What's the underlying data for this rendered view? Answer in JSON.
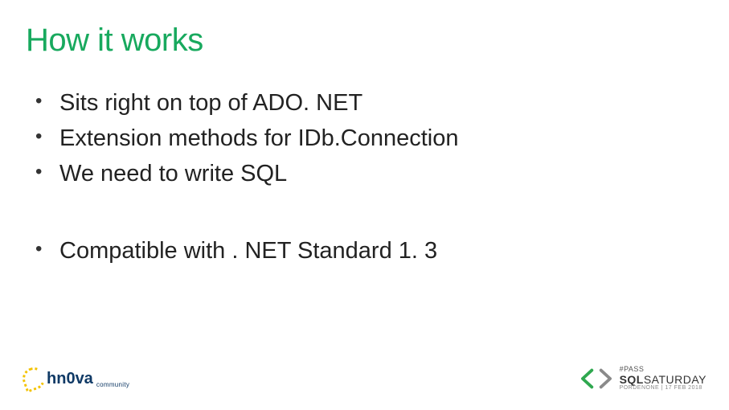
{
  "title": "How it works",
  "bullets_group1": [
    "Sits right on top of ADO. NET",
    "Extension methods for IDb.Connection",
    "We need to write SQL"
  ],
  "bullets_group2": [
    "Compatible with . NET Standard 1. 3"
  ],
  "footer": {
    "left": {
      "brand_part1": "hn",
      "brand_part2": "0",
      "brand_part3": "va",
      "subtitle": "community"
    },
    "right": {
      "pass": "#PASS",
      "sql": "SQL",
      "saturday": "SATURDAY",
      "location": "PORDENONE | 17 FEB 2018"
    }
  }
}
